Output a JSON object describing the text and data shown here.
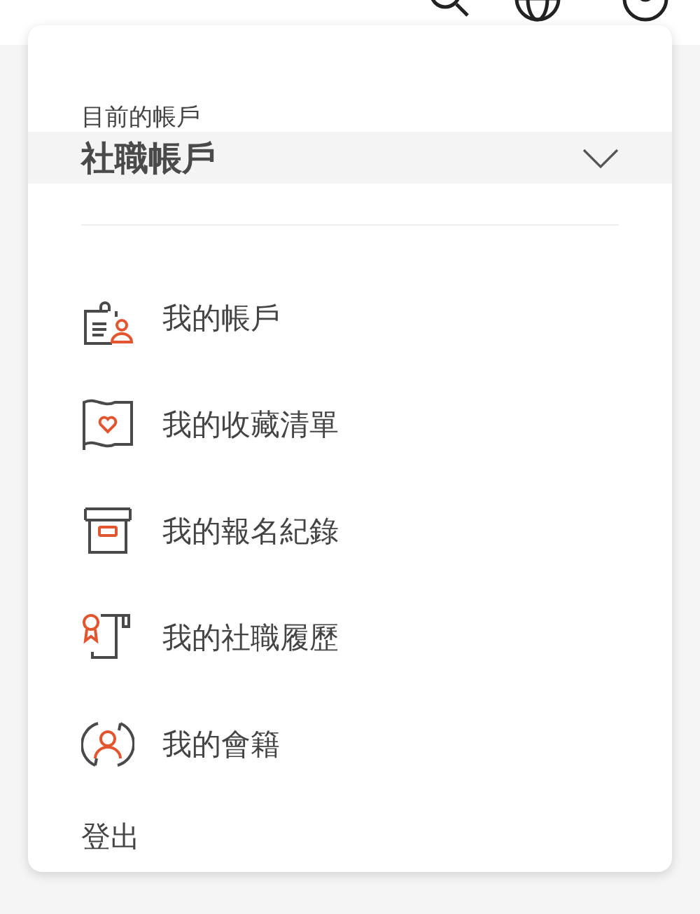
{
  "account_menu": {
    "current_label": "目前的帳戶",
    "current_account": "社職帳戶",
    "expanded": false,
    "items": [
      {
        "kind": "clipboard",
        "label": "我的帳戶"
      },
      {
        "kind": "flag",
        "label": "我的收藏清單"
      },
      {
        "kind": "box",
        "label": "我的報名紀錄"
      },
      {
        "kind": "scroll",
        "label": "我的社職履歷"
      },
      {
        "kind": "member",
        "label": "我的會籍"
      }
    ],
    "logout": "登出"
  }
}
